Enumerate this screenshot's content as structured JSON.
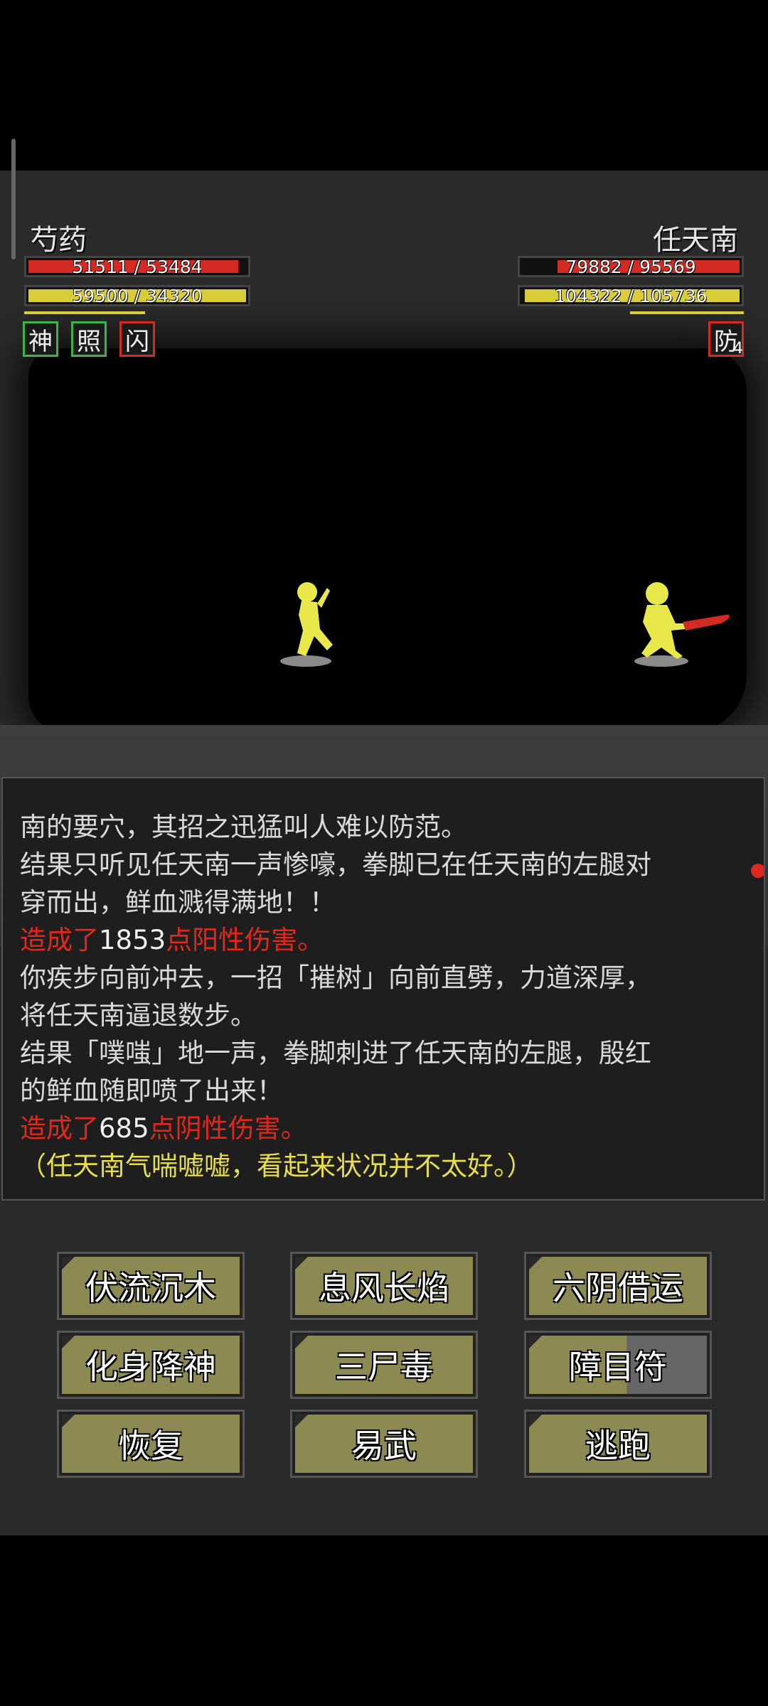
{
  "player": {
    "name": "芍药",
    "hp_text": "51511 / 53484",
    "hp_fraction": 0.963,
    "mp_text": "59500 / 34320",
    "mp_fraction": 1.0,
    "hp_color": "#d42a24",
    "mp_color": "#d8cc3a",
    "buffs": [
      {
        "label": "神",
        "border": "#3cb44a"
      },
      {
        "label": "照",
        "border": "#3cb44a"
      },
      {
        "label": "闪",
        "border": "#d42a24"
      }
    ]
  },
  "enemy": {
    "name": "任天南",
    "hp_text": "79882 / 95569",
    "hp_fraction": 0.836,
    "mp_text": "104322 / 105736",
    "mp_fraction": 0.987,
    "hp_color": "#d42a24",
    "mp_color": "#d8cc3a",
    "buffs": [
      {
        "label": "防",
        "border": "#d42a24",
        "count": "4"
      }
    ]
  },
  "log": {
    "lines": [
      [
        {
          "text": "南的要穴，其招之迅猛叫人难以防范。",
          "color": "gray"
        }
      ],
      [
        {
          "text": "结果只听见任天南一声惨嚎，拳脚已在任天南的左腿对",
          "color": "gray"
        }
      ],
      [
        {
          "text": "穿而出，鲜血溅得满地！！",
          "color": "gray"
        }
      ],
      [
        {
          "text": "造成了",
          "color": "red"
        },
        {
          "text": "1853",
          "color": "white"
        },
        {
          "text": "点阳性伤害。",
          "color": "red"
        }
      ],
      [
        {
          "text": "你疾步向前冲去，一招「摧树」向前直劈，力道深厚，",
          "color": "gray"
        }
      ],
      [
        {
          "text": "将任天南逼退数步。",
          "color": "gray"
        }
      ],
      [
        {
          "text": "结果「噗嗤」地一声，拳脚刺进了任天南的左腿，殷红",
          "color": "gray"
        }
      ],
      [
        {
          "text": "的鲜血随即喷了出来！",
          "color": "gray"
        }
      ],
      [
        {
          "text": "造成了",
          "color": "red"
        },
        {
          "text": "685",
          "color": "white"
        },
        {
          "text": "点阴性伤害。",
          "color": "red"
        }
      ],
      [
        {
          "text": "（任天南气喘嘘嘘，看起来状况并不太好。）",
          "color": "yellow"
        }
      ]
    ]
  },
  "skills": {
    "row1": [
      "伏流沉木",
      "息风长焰",
      "六阴借运"
    ],
    "row2": [
      "化身降神",
      "三尸毒",
      "障目符"
    ],
    "row3": [
      "恢复",
      "易武",
      "逃跑"
    ]
  }
}
